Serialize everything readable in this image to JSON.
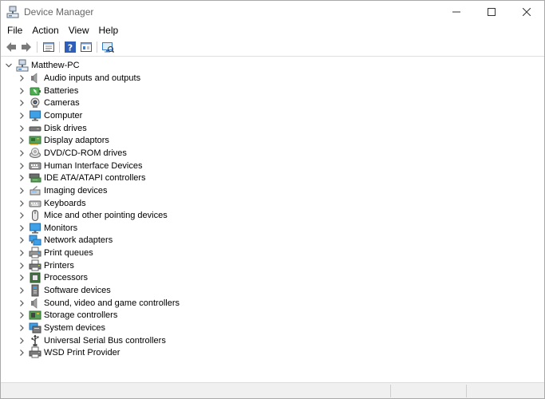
{
  "window": {
    "title": "Device Manager",
    "app_icon": "device-manager-icon",
    "controls": [
      "minimize-icon",
      "maximize-icon",
      "close-icon"
    ]
  },
  "menu": [
    "File",
    "Action",
    "View",
    "Help"
  ],
  "toolbar": {
    "buttons": [
      "back-arrow-icon",
      "forward-arrow-icon",
      "properties-view-icon",
      "help-icon",
      "update-driver-icon",
      "scan-hardware-icon"
    ]
  },
  "tree": {
    "root": {
      "label": "Matthew-PC",
      "icon": "computer-tree-root-icon",
      "expanded": true
    },
    "categories": [
      {
        "label": "Audio inputs and outputs",
        "icon": "speaker-icon"
      },
      {
        "label": "Batteries",
        "icon": "battery-icon"
      },
      {
        "label": "Cameras",
        "icon": "camera-icon"
      },
      {
        "label": "Computer",
        "icon": "monitor-icon"
      },
      {
        "label": "Disk drives",
        "icon": "disk-drive-icon"
      },
      {
        "label": "Display adaptors",
        "icon": "display-adapter-icon"
      },
      {
        "label": "DVD/CD-ROM drives",
        "icon": "optical-drive-icon"
      },
      {
        "label": "Human Interface Devices",
        "icon": "hid-icon"
      },
      {
        "label": "IDE ATA/ATAPI controllers",
        "icon": "ide-controller-icon"
      },
      {
        "label": "Imaging devices",
        "icon": "imaging-device-icon"
      },
      {
        "label": "Keyboards",
        "icon": "keyboard-icon"
      },
      {
        "label": "Mice and other pointing devices",
        "icon": "mouse-icon"
      },
      {
        "label": "Monitors",
        "icon": "monitor-icon"
      },
      {
        "label": "Network adapters",
        "icon": "network-adapter-icon"
      },
      {
        "label": "Print queues",
        "icon": "print-queue-icon"
      },
      {
        "label": "Printers",
        "icon": "printer-icon"
      },
      {
        "label": "Processors",
        "icon": "processor-icon"
      },
      {
        "label": "Software devices",
        "icon": "software-device-icon"
      },
      {
        "label": "Sound, video and game controllers",
        "icon": "speaker-icon"
      },
      {
        "label": "Storage controllers",
        "icon": "storage-controller-icon"
      },
      {
        "label": "System devices",
        "icon": "system-device-icon"
      },
      {
        "label": "Universal Serial Bus controllers",
        "icon": "usb-icon"
      },
      {
        "label": "WSD Print Provider",
        "icon": "printer-icon"
      }
    ]
  },
  "statusbar": {
    "text": ""
  },
  "colors": {
    "accent": "#0078d7",
    "folder_yellow": "#f7c948",
    "chevron": "#555555"
  }
}
